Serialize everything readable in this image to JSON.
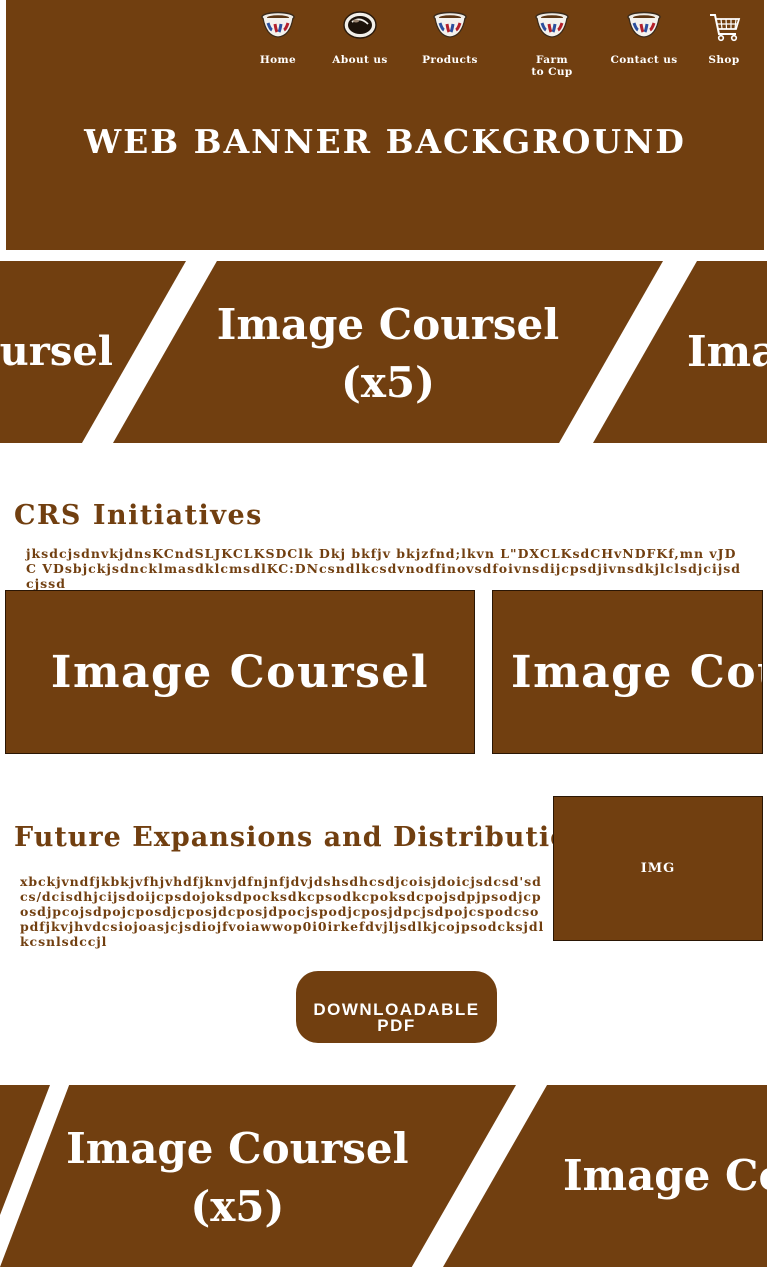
{
  "nav": {
    "items": [
      {
        "label": "Home",
        "icon": "coffee-cup-icon"
      },
      {
        "label": "About us",
        "icon": "coffee-bean-icon"
      },
      {
        "label": "Products",
        "icon": "coffee-cup-icon"
      },
      {
        "label": "Farm to Cup",
        "icon": "coffee-cup-icon"
      },
      {
        "label": "Contact us",
        "icon": "coffee-cup-icon"
      },
      {
        "label": "Shop",
        "icon": "shopping-cart-icon"
      }
    ]
  },
  "banner": {
    "title": "WEB BANNER BACKGROUND"
  },
  "carousel_top": {
    "slides": [
      {
        "label": "ursel"
      },
      {
        "label": "Image Coursel\n(x5)"
      },
      {
        "label": "Ima"
      }
    ]
  },
  "crs": {
    "title": "CRS Initiatives",
    "body": "jksdcjsdnvkjdnsKCndSLJKCLKSDClk Dkj bkfjv bkjzfnd;lkvn L\"DXCLKsdCHvNDFKf,mn vJDC VDsbjckjsdncklmasdklcmsdlKC:DNcsndlkcsdvnodfinovsdfoivnsdijcpsdjivnsdkjlclsdjcijsdcjssd",
    "slides": [
      {
        "label": "Image Coursel"
      },
      {
        "label": "Image Coursel"
      }
    ]
  },
  "future": {
    "title": "Future Expansions and Distribution",
    "body": "xbckjvndfjkbkjvfhjvhdfjknvjdfnjnfjdvjdshsdhcsdjcoisjdoicjsdcsd'sdcs/dcisdhjcijsdoijcpsdojoksdpocksdkcpsodkcpoksdcpojsdpjpsodjcposdjpcojsdpojcposdjcposjdcposjdpocjspodjcposjdpcjsdpojcspodcsopdfjkvjhvdcsiojoasjcjsdiojfvoiawwop0i0irkefdvjljsdlkjcojpsodcksjdlkcsnlsdccjl",
    "image_label": "IMG",
    "button_label": "DOWNLOADABLE PDF"
  },
  "carousel_bottom": {
    "slides": [
      {
        "label": ""
      },
      {
        "label": "Image Coursel\n(x5)"
      },
      {
        "label": "Image Co"
      }
    ]
  },
  "colors": {
    "brand_brown": "#713f10",
    "text_white": "#ffffff",
    "background": "#ffffff"
  }
}
